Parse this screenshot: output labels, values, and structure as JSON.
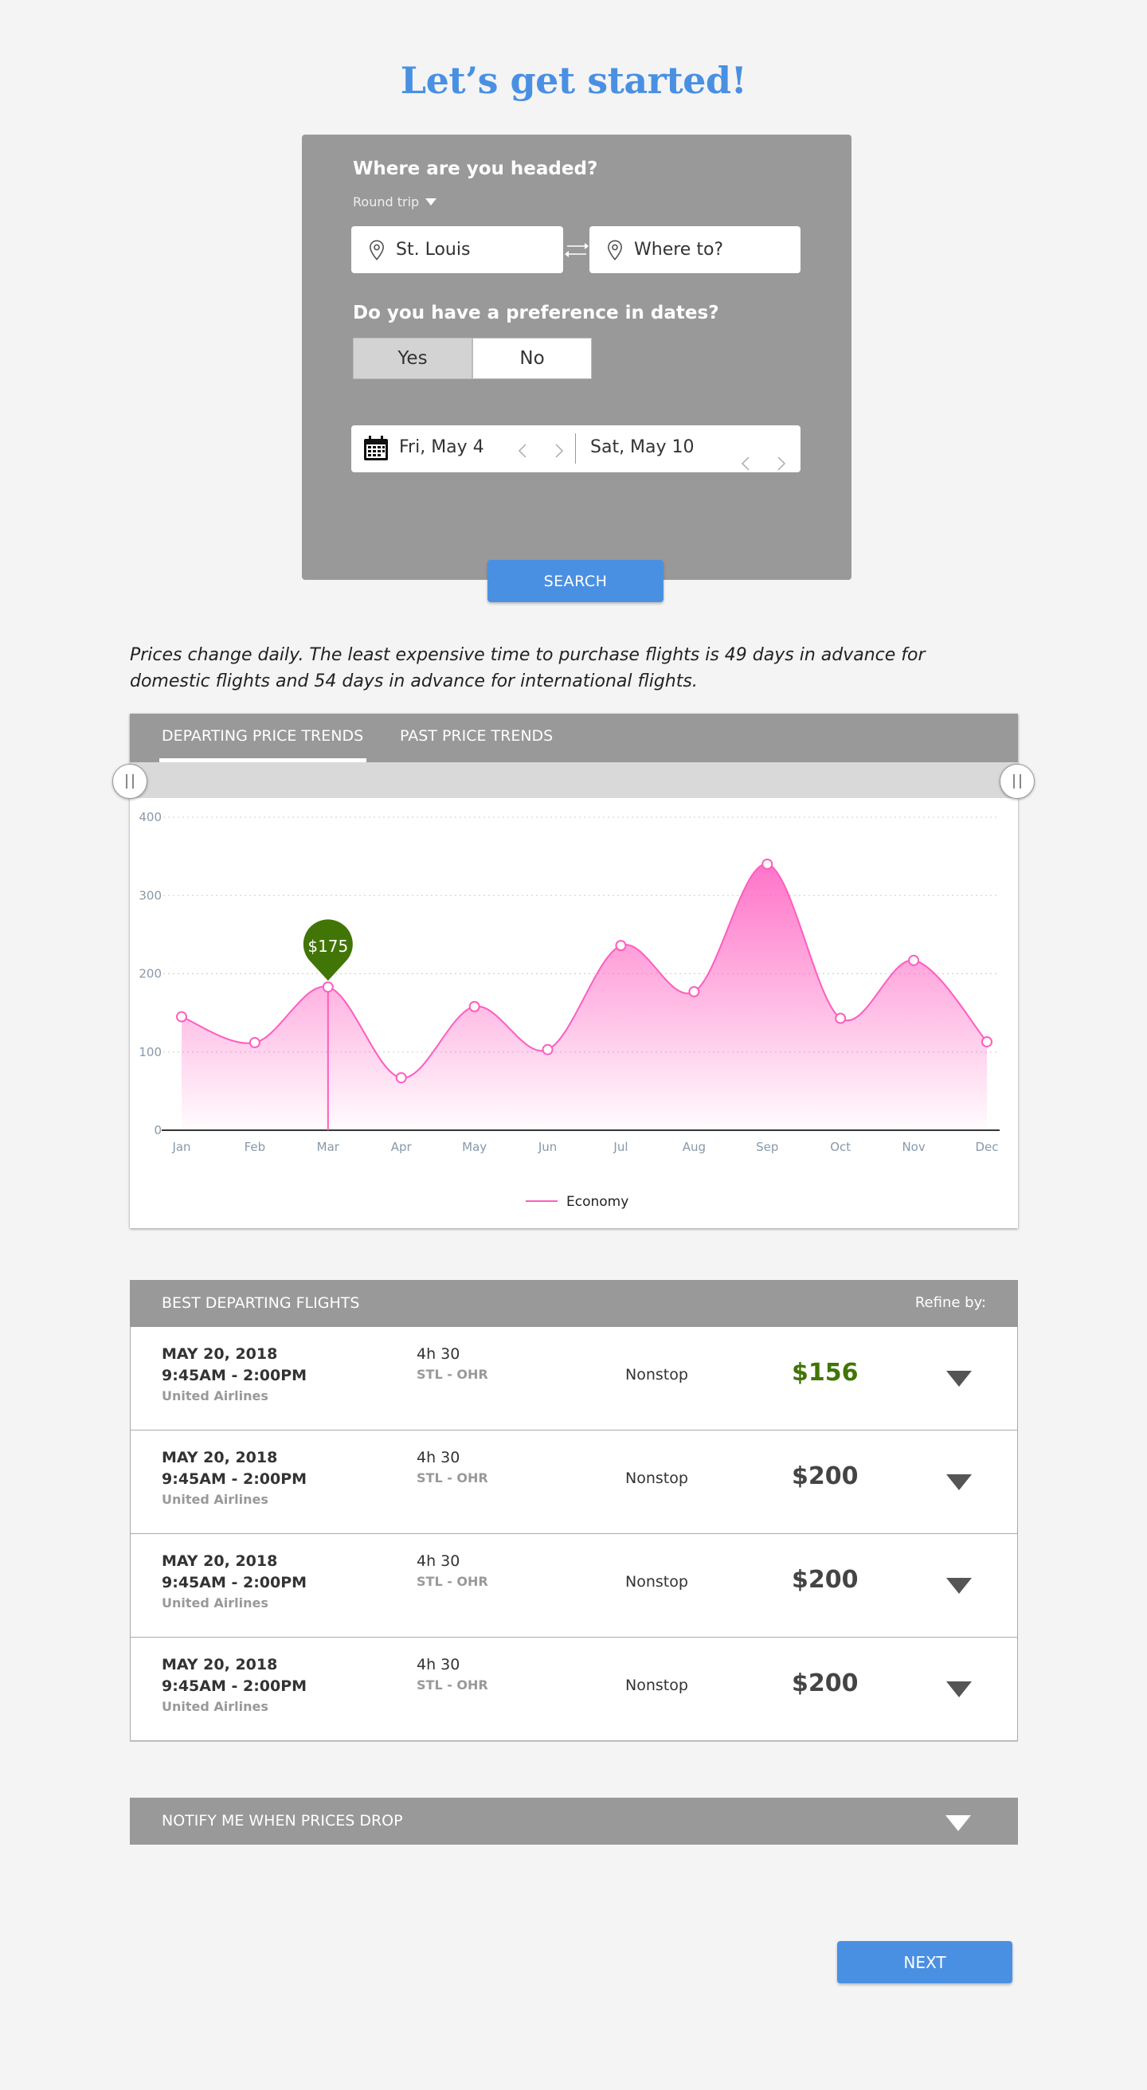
{
  "page": {
    "title": "Let’s get started!"
  },
  "search": {
    "heading": "Where are you headed?",
    "trip_type": "Round trip",
    "from_value": "St. Louis",
    "to_placeholder": "Where to?",
    "date_pref_heading": "Do you have a preference in dates?",
    "date_pref_options": [
      "Yes",
      "No"
    ],
    "date_pref_selected": "Yes",
    "depart_date": "Fri, May 4",
    "return_date": "Sat, May 10",
    "search_label": "SEARCH"
  },
  "info_text": "Prices change daily. The least expensive time to purchase flights is 49 days in advance for domestic flights and 54 days in advance for international flights.",
  "trends": {
    "tabs": [
      "DEPARTING PRICE TRENDS",
      "PAST PRICE TRENDS"
    ],
    "active_tab": "DEPARTING PRICE TRENDS",
    "tooltip": "$175"
  },
  "chart_data": {
    "type": "area",
    "categories": [
      "Jan",
      "Feb",
      "Mar",
      "Apr",
      "May",
      "Jun",
      "Jul",
      "Aug",
      "Sep",
      "Oct",
      "Nov",
      "Dec"
    ],
    "series": [
      {
        "name": "Economy",
        "values": [
          145,
          112,
          183,
          67,
          158,
          103,
          236,
          177,
          340,
          143,
          217,
          113
        ],
        "color": "#ff5cbf"
      }
    ],
    "yticks": [
      0,
      100,
      200,
      300,
      400
    ],
    "ylim": [
      0,
      400
    ],
    "highlight": {
      "category": "Mar",
      "label": "$175",
      "color": "#417505"
    },
    "grid": "horizontal dotted",
    "legend": "bottom-center"
  },
  "flights": {
    "heading": "BEST DEPARTING FLIGHTS",
    "refine_label": "Refine by:",
    "rows": [
      {
        "date": "MAY 20, 2018",
        "time": "9:45AM - 2:00PM",
        "airline": "United Airlines",
        "duration": "4h 30",
        "route": "STL - OHR",
        "stops": "Nonstop",
        "price": "$156"
      },
      {
        "date": "MAY 20, 2018",
        "time": "9:45AM - 2:00PM",
        "airline": "United Airlines",
        "duration": "4h 30",
        "route": "STL - OHR",
        "stops": "Nonstop",
        "price": "$200"
      },
      {
        "date": "MAY 20, 2018",
        "time": "9:45AM - 2:00PM",
        "airline": "United Airlines",
        "duration": "4h 30",
        "route": "STL - OHR",
        "stops": "Nonstop",
        "price": "$200"
      },
      {
        "date": "MAY 20, 2018",
        "time": "9:45AM - 2:00PM",
        "airline": "United Airlines",
        "duration": "4h 30",
        "route": "STL - OHR",
        "stops": "Nonstop",
        "price": "$200"
      }
    ]
  },
  "notify_label": "NOTIFY ME WHEN PRICES DROP",
  "next_label": "NEXT",
  "colors": {
    "accent": "#4a90e2",
    "panel": "#999999",
    "best_price": "#417505",
    "chart_line": "#ff5cbf"
  }
}
